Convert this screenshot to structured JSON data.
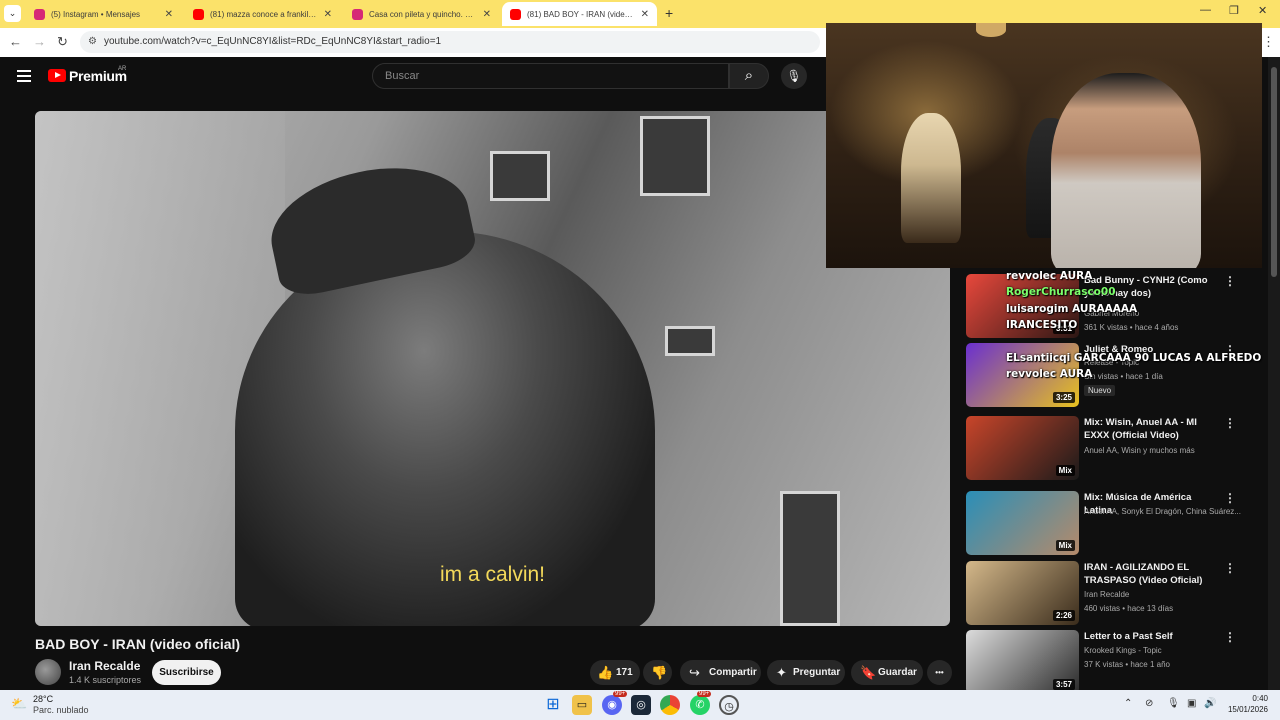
{
  "browser": {
    "tabs": [
      {
        "title": "(5) Instagram • Mensajes",
        "favicon_color": "#d62976"
      },
      {
        "title": "(81) mazza conoce a frankillo -",
        "favicon_color": "#ff0000"
      },
      {
        "title": "Casa con pileta y quincho. Solo",
        "favicon_color": "#d62976"
      },
      {
        "title": "(81) BAD BOY - IRAN (video ofic",
        "favicon_color": "#ff0000"
      }
    ],
    "new_tab": "+",
    "url": "youtube.com/watch?v=c_EqUnNC8YI&list=RDc_EqUnNC8YI&start_radio=1"
  },
  "youtube": {
    "brand": "Premium",
    "region": "AR",
    "search_placeholder": "Buscar"
  },
  "video": {
    "subtitle": "im a calvin!",
    "title": "BAD BOY - IRAN (video oficial)",
    "channel": "Iran Recalde",
    "subscribers": "1.4 K suscriptores",
    "subscribe_label": "Suscribirse",
    "likes": "171",
    "share_label": "Compartir",
    "ask_label": "Preguntar",
    "save_label": "Guardar",
    "more_label": "•••"
  },
  "sidebar": {
    "items": [
      {
        "title": "Bad Bunny - CYNH2 (Como yo no hay dos)",
        "channel": "Gabriel Moreno",
        "meta": "361 K vistas • hace 4 años",
        "badge": "3:31",
        "thumb_a": "#e8483c",
        "thumb_b": "#2b1714"
      },
      {
        "title": "Juliet & Romeo",
        "channel": "Release - Topic",
        "meta": "Sin vistas • hace 1 día",
        "new_label": "Nuevo",
        "badge": "3:25",
        "thumb_a": "#6a2fd0",
        "thumb_b": "#e8c21e"
      },
      {
        "title": "Mix: Wisin, Anuel AA - MI EXXX (Official Video)",
        "channel": "Anuel AA, Wisin y muchos más",
        "badge": "Mix",
        "thumb_a": "#c9452a",
        "thumb_b": "#1a1a1a"
      },
      {
        "title": "Mix: Música de América Latina",
        "channel": "Anuel AA, Sonyk El Dragón, China Suárez...",
        "badge": "Mix",
        "thumb_a": "#2a8fb8",
        "thumb_b": "#b58a6a"
      },
      {
        "title": "IRAN - AGILIZANDO EL TRASPASO (Video Oficial)",
        "channel": "Iran Recalde",
        "meta": "460 vistas • hace 13 días",
        "badge": "2:26",
        "thumb_a": "#d4b88a",
        "thumb_b": "#3a2c1c"
      },
      {
        "title": "Letter to a Past Self",
        "channel": "Krooked Kings - Topic",
        "meta": "37 K vistas • hace 1 año",
        "badge": "3:57",
        "thumb_a": "#dcdcdc",
        "thumb_b": "#2a2a2a"
      }
    ]
  },
  "chat": [
    {
      "text": "revvolec AURA",
      "color": "#ffffff"
    },
    {
      "text": "RogerChurrasco00",
      "color": "#7cff6b"
    },
    {
      "text": "luisarogim AURAAAAA",
      "color": "#ffffff"
    },
    {
      "text": "IRANCESITO",
      "color": "#ffffff"
    },
    {
      "text": "ELsantiicqi GARCAAA 90 LUCAS A ALFREDO",
      "color": "#ffffff"
    },
    {
      "text": "revvolec AURA",
      "color": "#ffffff"
    }
  ],
  "taskbar": {
    "temp": "28°C",
    "weather": "Parc. nublado",
    "time": "0:40",
    "date": "15/01/2026",
    "badge_discord": "99+",
    "badge_whatsapp": "99+"
  }
}
